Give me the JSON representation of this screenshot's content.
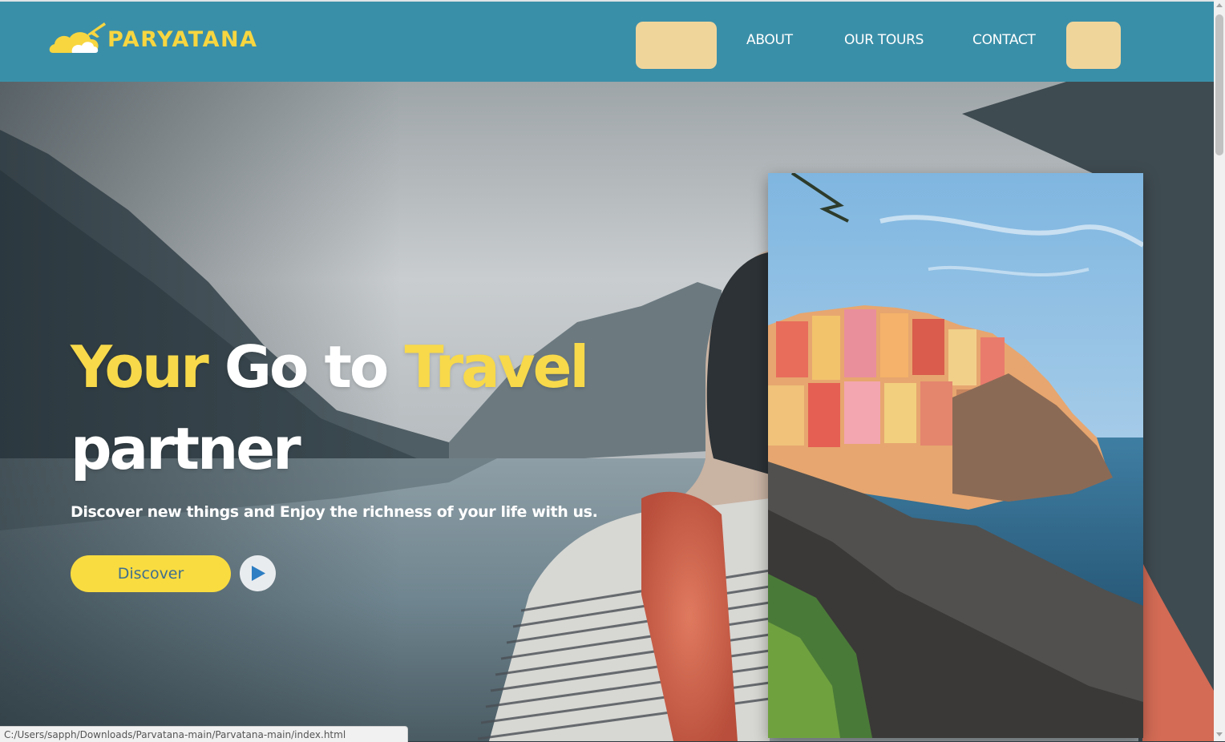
{
  "brand": {
    "name": "PARYATANA"
  },
  "nav": {
    "items": [
      {
        "label": "ABOUT"
      },
      {
        "label": "OUR TOURS"
      },
      {
        "label": "CONTACT"
      }
    ],
    "home_pill_label": "",
    "cta_pill_label": ""
  },
  "hero": {
    "headline_parts": [
      "Your",
      "Go to",
      "Travel",
      "partner"
    ],
    "tagline": "Discover new things and Enjoy the richness of your life with us.",
    "discover_button": "Discover",
    "play_icon": "play-icon"
  },
  "featured_image": {
    "subject": "coastal cliff village"
  },
  "status_bar": {
    "url": "C:/Users/sapph/Downloads/Parvatana-main/Parvatana-main/index.html"
  },
  "colors": {
    "header": "#3a8fa8",
    "brand_yellow": "#f7d640",
    "nav_pill": "#f0d59b",
    "button_yellow": "#f9dc40",
    "button_text": "#3f6f8f"
  }
}
